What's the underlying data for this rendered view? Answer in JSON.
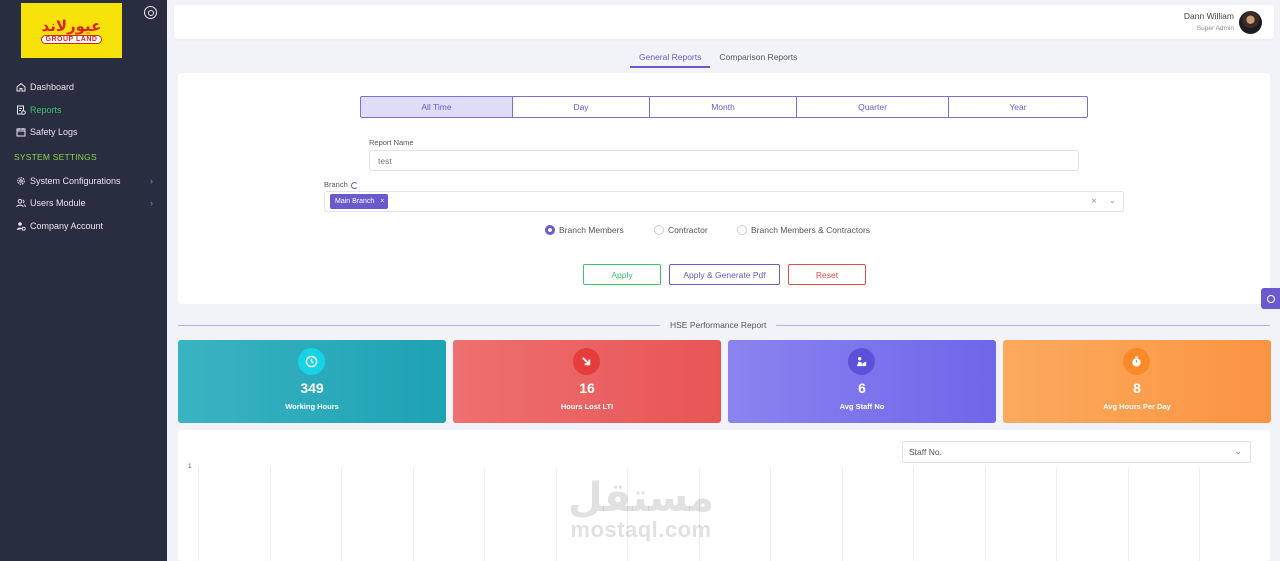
{
  "sidebar": {
    "logo": {
      "arabic": "عيورلاند",
      "english": "GROUP LAND"
    },
    "items": [
      {
        "label": "Dashboard",
        "icon": "home-icon"
      },
      {
        "label": "Reports",
        "icon": "report-icon",
        "active": true
      },
      {
        "label": "Safety Logs",
        "icon": "calendar-icon"
      }
    ],
    "section_title": "SYSTEM SETTINGS",
    "settings_items": [
      {
        "label": "System Configurations",
        "icon": "gear-icon"
      },
      {
        "label": "Users Module",
        "icon": "users-icon"
      },
      {
        "label": "Company Account",
        "icon": "user-gear-icon"
      }
    ]
  },
  "header": {
    "user_name": "Dann William",
    "user_role": "Super Admin"
  },
  "tabs": [
    {
      "label": "General Reports",
      "active": true
    },
    {
      "label": "Comparison Reports",
      "active": false
    }
  ],
  "filters": {
    "periods": [
      "All Time",
      "Day",
      "Month",
      "Quarter",
      "Year"
    ],
    "active_period": "All Time",
    "report_name_label": "Report Name",
    "report_name_value": "test",
    "branch_label": "Branch",
    "branch_chip": "Main Branch",
    "radios": [
      {
        "label": "Branch Members",
        "checked": true
      },
      {
        "label": "Contractor",
        "checked": false
      },
      {
        "label": "Branch Members & Contractors",
        "checked": false
      }
    ],
    "buttons": {
      "apply": "Apply",
      "apply_pdf": "Apply & Generate Pdf",
      "reset": "Reset"
    }
  },
  "section_title": "HSE Performance Report",
  "stats": [
    {
      "value": "349",
      "label": "Working Hours",
      "icon": "clock-icon",
      "color": "#2aacbc"
    },
    {
      "value": "16",
      "label": "Hours Lost LTI",
      "icon": "arrow-down-right-icon",
      "color": "#ea6262"
    },
    {
      "value": "6",
      "label": "Avg Staff No",
      "icon": "worker-icon",
      "color": "#7c75ec"
    },
    {
      "value": "8",
      "label": "Avg Hours Per Day",
      "icon": "stopwatch-icon",
      "color": "#fb9f50"
    }
  ],
  "chart": {
    "select_value": "Staff No.",
    "y_tick": "1"
  },
  "watermark": {
    "arabic": "مستقل",
    "english": "mostaql.com"
  },
  "colors": {
    "accent": "#6a5acd",
    "sidebar_bg": "#282d40",
    "success": "#3ec46d",
    "danger": "#e05050"
  }
}
